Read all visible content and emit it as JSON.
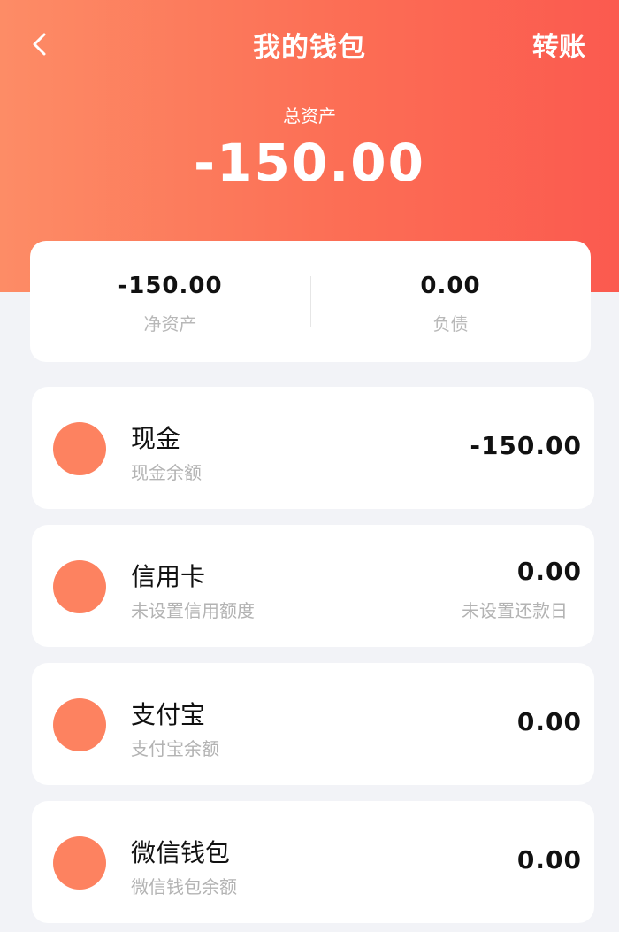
{
  "header": {
    "title": "我的钱包",
    "transfer_label": "转账",
    "total_label": "总资产",
    "total_value": "-150.00",
    "gradient_colors": [
      "#fd8c66",
      "#fb5a4f"
    ]
  },
  "summary": {
    "net_assets_value": "-150.00",
    "net_assets_label": "净资产",
    "liabilities_value": "0.00",
    "liabilities_label": "负债"
  },
  "accounts": [
    {
      "name": "现金",
      "subtitle": "现金余额",
      "amount": "-150.00",
      "right_subtitle": "",
      "icon": "orange-circle-icon"
    },
    {
      "name": "信用卡",
      "subtitle": "未设置信用额度",
      "amount": "0.00",
      "right_subtitle": "未设置还款日",
      "icon": "orange-circle-icon"
    },
    {
      "name": "支付宝",
      "subtitle": "支付宝余额",
      "amount": "0.00",
      "right_subtitle": "",
      "icon": "orange-circle-icon"
    },
    {
      "name": "微信钱包",
      "subtitle": "微信钱包余额",
      "amount": "0.00",
      "right_subtitle": "",
      "icon": "orange-circle-icon"
    }
  ],
  "colors": {
    "accent": "#fd8260",
    "background": "#f2f3f7"
  }
}
